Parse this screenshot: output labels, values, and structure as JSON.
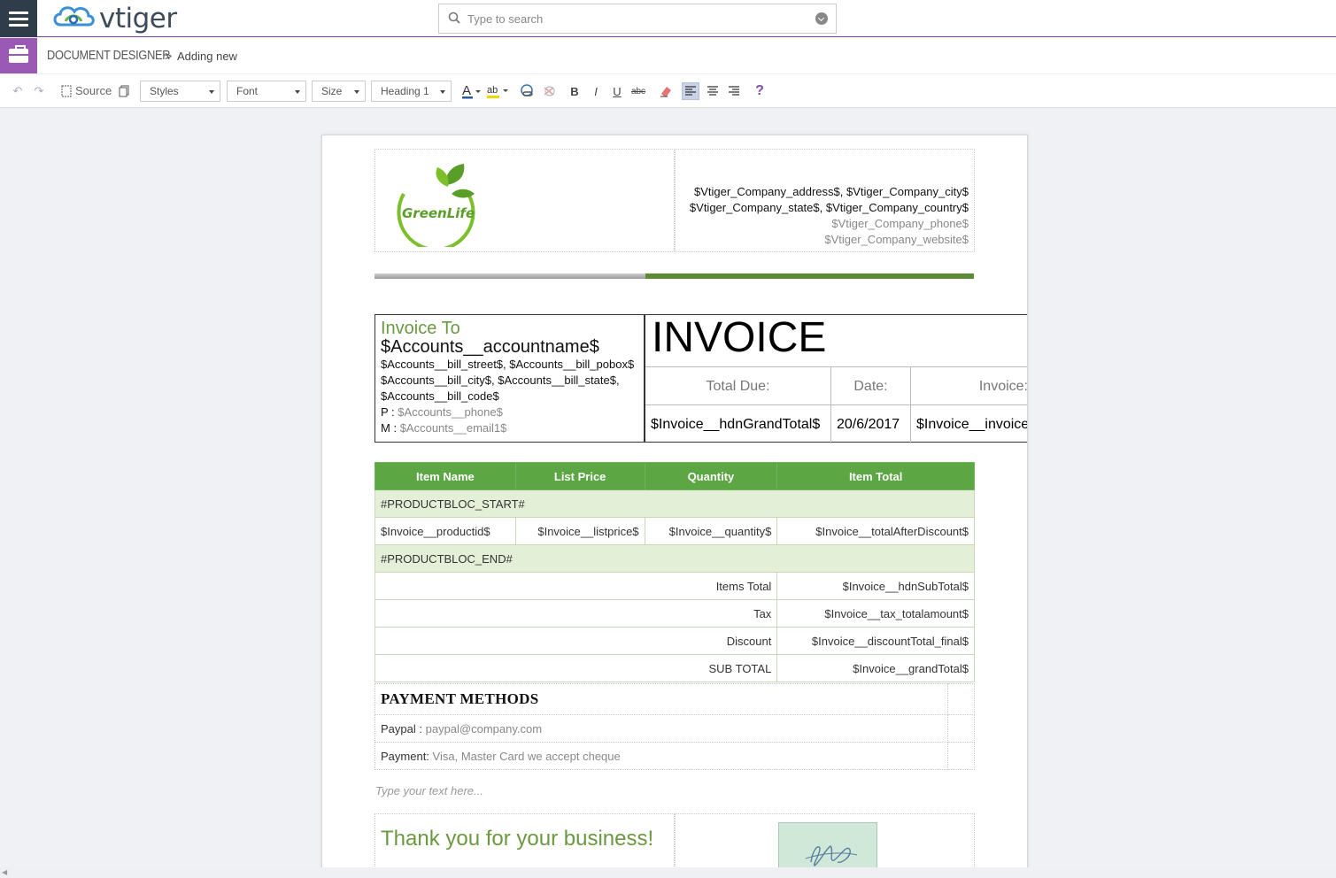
{
  "header": {
    "logo_text": "vtiger",
    "search_placeholder": "Type to search"
  },
  "breadcrumb": {
    "module": "DOCUMENT DESIGNER",
    "separator": ">",
    "current": "Adding new"
  },
  "toolbar": {
    "source_label": "Source",
    "styles_label": "Styles",
    "font_label": "Font",
    "size_label": "Size",
    "format_label": "Heading 1",
    "bold": "B",
    "italic": "I",
    "underline": "U",
    "strike": "abc",
    "help": "?"
  },
  "document": {
    "logo_text": "GreenLife",
    "company_line1": "$Vtiger_Company_address$, $Vtiger_Company_city$",
    "company_line2": "$Vtiger_Company_state$, $Vtiger_Company_country$",
    "company_phone": "$Vtiger_Company_phone$",
    "company_website": "$Vtiger_Company_website$",
    "invoice_to_label": "Invoice To",
    "account_name": "$Accounts__accountname$",
    "bill_line1": "$Accounts__bill_street$, $Accounts__bill_pobox$",
    "bill_line2": "$Accounts__bill_city$, $Accounts__bill_state$,",
    "bill_line3": "$Accounts__bill_code$",
    "phone_label": "P :",
    "phone_value": "$Accounts__phone$",
    "mobile_label": "M :",
    "mobile_value": "$Accounts__email1$",
    "invoice_title": "INVOICE",
    "total_due_label": "Total Due:",
    "date_label": "Date:",
    "invoice_label": "Invoice:",
    "total_due_value": "$Invoice__hdnGrandTotal$",
    "date_value": "20/6/2017",
    "invoice_value": "$Invoice__invoice_no$",
    "items_headers": [
      "Item Name",
      "List Price",
      "Quantity",
      "Item Total"
    ],
    "block_start": "#PRODUCTBLOC_START#",
    "item_row": [
      "$Invoice__productid$",
      "$Invoice__listprice$",
      "$Invoice__quantity$",
      "$Invoice__totalAfterDiscount$"
    ],
    "block_end": "#PRODUCTBLOC_END#",
    "totals": [
      {
        "label": "Items Total",
        "value": "$Invoice__hdnSubTotal$"
      },
      {
        "label": "Tax",
        "value": "$Invoice__tax_totalamount$"
      },
      {
        "label": "Discount",
        "value": "$Invoice__discountTotal_final$"
      },
      {
        "label": "SUB TOTAL",
        "value": "$Invoice__grandTotal$"
      }
    ],
    "payment_heading": "PAYMENT METHODS",
    "paypal_label": "Paypal :",
    "paypal_value": "paypal@company.com",
    "payment_label": "Payment:",
    "payment_value": "Visa, Master Card we accept cheque",
    "placeholder_text": "Type your text here...",
    "thanks_text": "Thank you for your business!"
  },
  "colors": {
    "accent_purple": "#9b59b6",
    "brand_green": "#5da644",
    "header_dark": "#2f3d4a"
  }
}
